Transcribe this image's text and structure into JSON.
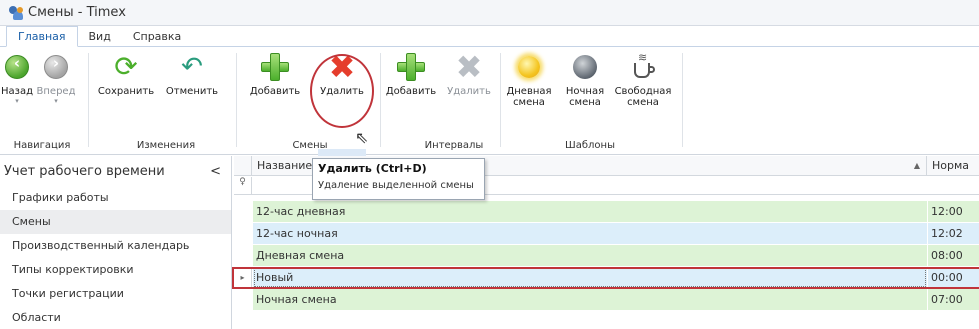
{
  "window": {
    "title": "Смены - Timex"
  },
  "tabs": [
    {
      "label": "Главная",
      "active": true
    },
    {
      "label": "Вид",
      "active": false
    },
    {
      "label": "Справка",
      "active": false
    }
  ],
  "ribbon": {
    "groups": {
      "navigation": "Навигация",
      "changes": "Изменения",
      "shifts": "Смены",
      "intervals": "Интервалы",
      "templates": "Шаблоны"
    },
    "buttons": {
      "back": "Назад",
      "forward": "Вперед",
      "save": "Сохранить",
      "cancel": "Отменить",
      "add_shift": "Добавить",
      "delete_shift": "Удалить",
      "add_interval": "Добавить",
      "delete_interval": "Удалить",
      "day_shift_1": "Дневная",
      "day_shift_2": "смена",
      "night_shift_1": "Ночная",
      "night_shift_2": "смена",
      "free_shift_1": "Свободная",
      "free_shift_2": "смена"
    }
  },
  "sidebar": {
    "header": "Учет рабочего времени",
    "collapse_glyph": "<",
    "items": [
      {
        "label": "Графики работы"
      },
      {
        "label": "Смены",
        "selected": true
      },
      {
        "label": "Производственный календарь"
      },
      {
        "label": "Типы корректировки"
      },
      {
        "label": "Точки регистрации"
      },
      {
        "label": "Области"
      }
    ]
  },
  "grid": {
    "columns": {
      "name": "Название",
      "norm": "Норма"
    },
    "sort_indicator": "▲",
    "rows": [
      {
        "name": "12-час дневная",
        "norm": "12:00",
        "color": "green"
      },
      {
        "name": "12-час ночная",
        "norm": "12:02",
        "color": "blue"
      },
      {
        "name": "Дневная смена",
        "norm": "08:00",
        "color": "green"
      },
      {
        "name": "Новый",
        "norm": "00:00",
        "color": "blue",
        "current": true
      },
      {
        "name": "Ночная смена",
        "norm": "07:00",
        "color": "green"
      }
    ]
  },
  "tooltip": {
    "title": "Удалить (Ctrl+D)",
    "description": "Удаление выделенной смены"
  }
}
